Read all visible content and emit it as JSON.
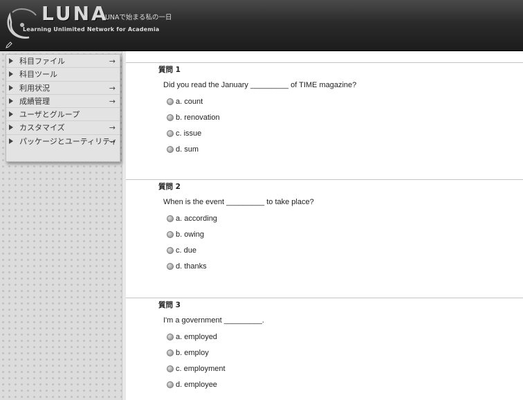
{
  "header": {
    "logo_text": "LUNA",
    "tagline": "LUNAで始まる私の一日",
    "subtitle": "Learning Unlimited Network for Academia",
    "colors": {
      "background": "#2a2a2a",
      "text": "#dddddd"
    }
  },
  "sidebar": {
    "menu": [
      {
        "label": "科目ファイル",
        "arrow": "→"
      },
      {
        "label": "科目ツール",
        "arrow": ""
      },
      {
        "label": "利用状況",
        "arrow": "→"
      },
      {
        "label": "成績管理",
        "arrow": "→"
      },
      {
        "label": "ユーザとグループ",
        "arrow": ""
      },
      {
        "label": "カスタマイズ",
        "arrow": "→"
      },
      {
        "label": "パッケージとユーティリティ",
        "arrow": "→"
      }
    ]
  },
  "questions": [
    {
      "title": "質問 1",
      "text": "Did you read the January _________ of TIME magazine?",
      "choices": [
        "a. count",
        "b. renovation",
        "c. issue",
        "d. sum"
      ]
    },
    {
      "title": "質問 2",
      "text": "When is the event _________ to take place?",
      "choices": [
        "a. according",
        "b. owing",
        "c. due",
        "d. thanks"
      ]
    },
    {
      "title": "質問 3",
      "text": "I'm a government _________.",
      "choices": [
        "a. employed",
        "b. employ",
        "c. employment",
        "d. employee"
      ]
    }
  ]
}
